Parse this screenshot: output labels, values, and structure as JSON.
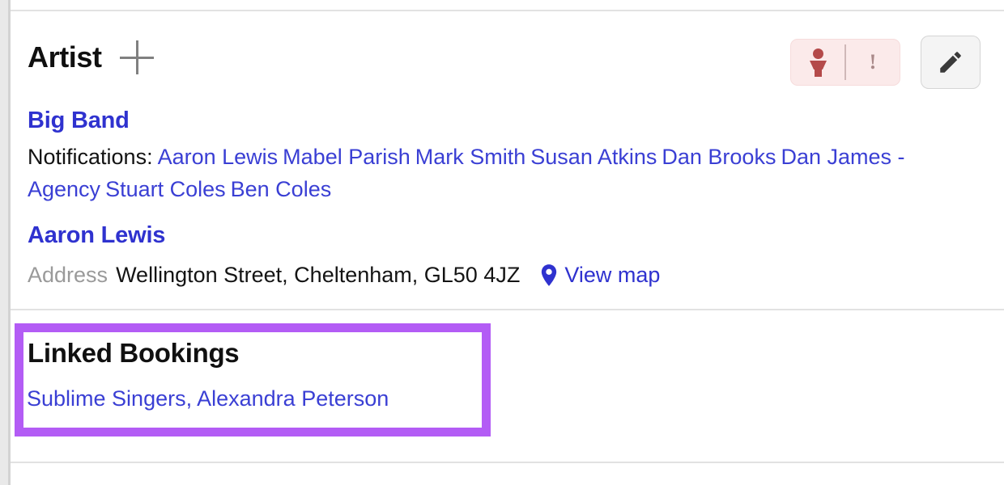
{
  "artist": {
    "title": "Artist",
    "add_icon": "plus-icon",
    "actions": {
      "alert_person_icon": "person-icon",
      "alert_warning_label": "!",
      "edit_icon": "pencil-icon"
    },
    "band_name": "Big Band",
    "notifications_label": "Notifications:",
    "notification_names": [
      "Aaron Lewis",
      "Mabel Parish",
      "Mark Smith",
      "Susan Atkins",
      "Dan Brooks",
      "Dan James - Agency",
      "Stuart Coles",
      "Ben Coles"
    ],
    "contact_name": "Aaron Lewis",
    "address_label": "Address",
    "address_value": "Wellington Street, Cheltenham, GL50 4JZ",
    "view_map_label": "View map",
    "map_pin_icon": "map-pin-icon"
  },
  "linked_bookings": {
    "title": "Linked Bookings",
    "value": "Sublime Singers, Alexandra Peterson",
    "highlight_color": "#b35cf5"
  },
  "colors": {
    "link_blue": "#2f32cf",
    "text_black": "#101010",
    "muted_gray": "#9a9a9a",
    "alert_bg": "#fbeaea",
    "alert_icon": "#b44a4a"
  }
}
